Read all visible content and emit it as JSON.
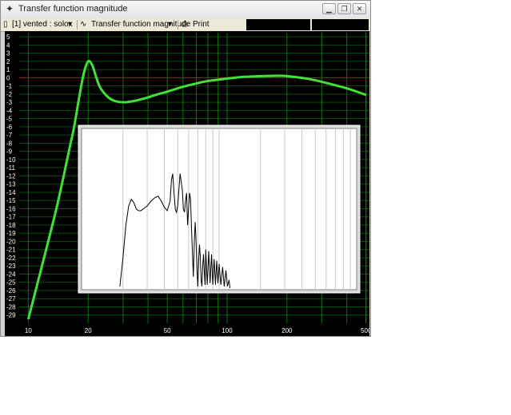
{
  "window": {
    "title": "Transfer function magnitude",
    "icons": {
      "app": "pin-icon",
      "minimize": "minimize-icon",
      "restore": "restore-icon",
      "close": "close-icon"
    }
  },
  "toolbar": {
    "device_selector": "[1] vented : solox",
    "view_selector": "Transfer function magnitude",
    "print_label": "Print"
  },
  "chart_data": [
    {
      "type": "line",
      "title": "",
      "xlabel": "",
      "ylabel": "",
      "x_scale": "log",
      "xlim": [
        9,
        520
      ],
      "ylim": [
        -30,
        5.5
      ],
      "x_ticks": [
        "10",
        "20",
        "50",
        "100",
        "200",
        "500"
      ],
      "y_ticks": [
        "5",
        "4",
        "3",
        "2",
        "1",
        "0",
        "-1",
        "-2",
        "-3",
        "-4",
        "-5",
        "-6",
        "-7",
        "-8",
        "-9",
        "-10",
        "-11",
        "-12",
        "-13",
        "-14",
        "-15",
        "-16",
        "-17",
        "-18",
        "-19",
        "-20",
        "-21",
        "-22",
        "-23",
        "-24",
        "-25",
        "-26",
        "-27",
        "-28",
        "-29"
      ],
      "grid": true,
      "colors": {
        "background": "#000000",
        "grid": "#0f8f0f",
        "curve": "#44e03a",
        "reference": "#b01020"
      },
      "reference_line_y": 0,
      "series": [
        {
          "x": [
            10,
            12,
            14,
            16,
            17,
            18,
            19,
            20,
            21,
            22,
            23,
            25,
            27,
            30,
            33,
            36,
            40,
            45,
            50,
            60,
            70,
            80,
            100,
            120,
            150,
            180,
            200,
            250,
            300,
            400,
            500
          ],
          "y": [
            -29.5,
            -22,
            -15.5,
            -9,
            -6,
            -2.5,
            0.5,
            2,
            1.5,
            0,
            -1.2,
            -2.3,
            -2.8,
            -3,
            -2.9,
            -2.7,
            -2.4,
            -2.0,
            -1.7,
            -1.1,
            -0.7,
            -0.4,
            -0.1,
            0.1,
            0.2,
            0.25,
            0.2,
            -0.1,
            -0.5,
            -1.3,
            -2.1
          ]
        }
      ]
    },
    {
      "type": "line",
      "title": "",
      "x_scale": "log",
      "xlim": [
        10,
        1000
      ],
      "ylim": [
        0,
        1
      ],
      "grid": true,
      "colors": {
        "background": "#ffffff",
        "grid": "#c8c8c8",
        "curve": "#000000"
      },
      "series": [
        {
          "x": [
            19,
            20,
            21,
            22,
            23,
            24,
            25,
            26,
            27,
            28,
            29,
            30,
            32,
            34,
            36,
            38,
            40,
            42,
            44,
            45,
            46,
            47,
            48,
            49,
            50,
            51,
            52,
            54,
            55,
            56,
            57,
            58,
            59,
            60,
            61,
            62,
            63,
            64,
            65,
            66,
            67,
            68,
            69,
            70,
            71,
            72,
            73,
            74,
            75,
            76,
            77,
            78,
            79,
            80,
            82,
            84,
            86,
            88,
            90,
            92,
            94,
            96,
            98,
            100,
            103,
            106,
            109,
            112,
            115,
            118,
            120
          ],
          "y": [
            0.02,
            0.2,
            0.4,
            0.52,
            0.56,
            0.54,
            0.5,
            0.49,
            0.49,
            0.5,
            0.51,
            0.52,
            0.55,
            0.57,
            0.58,
            0.55,
            0.51,
            0.49,
            0.55,
            0.68,
            0.72,
            0.6,
            0.5,
            0.48,
            0.52,
            0.62,
            0.72,
            0.62,
            0.5,
            0.48,
            0.55,
            0.6,
            0.4,
            0.5,
            0.6,
            0.56,
            0.38,
            0.22,
            0.08,
            0.3,
            0.42,
            0.3,
            0.12,
            0.02,
            0.18,
            0.28,
            0.2,
            0.06,
            0.02,
            0.15,
            0.22,
            0.12,
            0.03,
            0.25,
            0.03,
            0.24,
            0.04,
            0.22,
            0.03,
            0.19,
            0.03,
            0.18,
            0.04,
            0.16,
            0.03,
            0.14,
            0.02,
            0.12,
            0.02,
            0.06,
            0.01
          ]
        }
      ]
    }
  ]
}
